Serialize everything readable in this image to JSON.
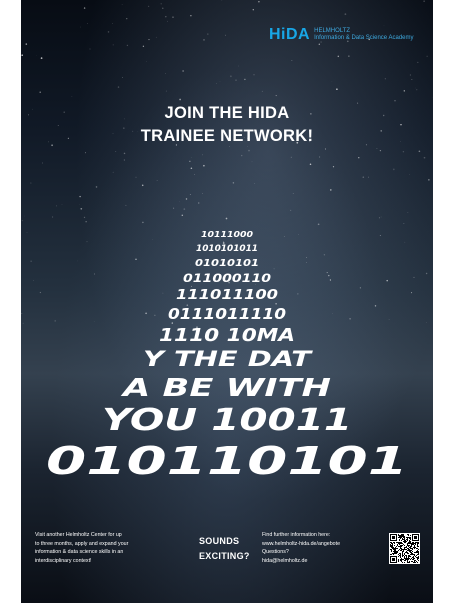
{
  "logo": {
    "mark": "HiDA",
    "line1": "HELMHOLTZ",
    "line2": "Information & Data Science Academy"
  },
  "headline": {
    "line1": "JOIN THE HIDA",
    "line2": "TRAINEE NETWORK!"
  },
  "code_rows": [
    "10111000",
    "1010101011",
    "01010101",
    "011000110",
    "111011100",
    "0111011110",
    "1110 10MA",
    "Y THE DAT",
    "A BE WITH",
    "YOU 10011",
    "010110101"
  ],
  "footer": {
    "visit": {
      "line1": "Visit another Helmholtz Center for up",
      "line2": "to three months, apply and expand your",
      "line3": "information & data science skills in an",
      "line4": "interdisciplinary context!"
    },
    "sounds": {
      "line1": "SOUNDS",
      "line2": "EXCITING?"
    },
    "info": {
      "line1": "Find further information here:",
      "line2": "www.helmholtz-hida.de/angebote",
      "line3": "Questions?",
      "line4": "hida@helmholtz.de"
    }
  },
  "colors": {
    "logo_blue": "#18a6e6",
    "sky_dark": "#070c14",
    "text": "#ffffff"
  }
}
